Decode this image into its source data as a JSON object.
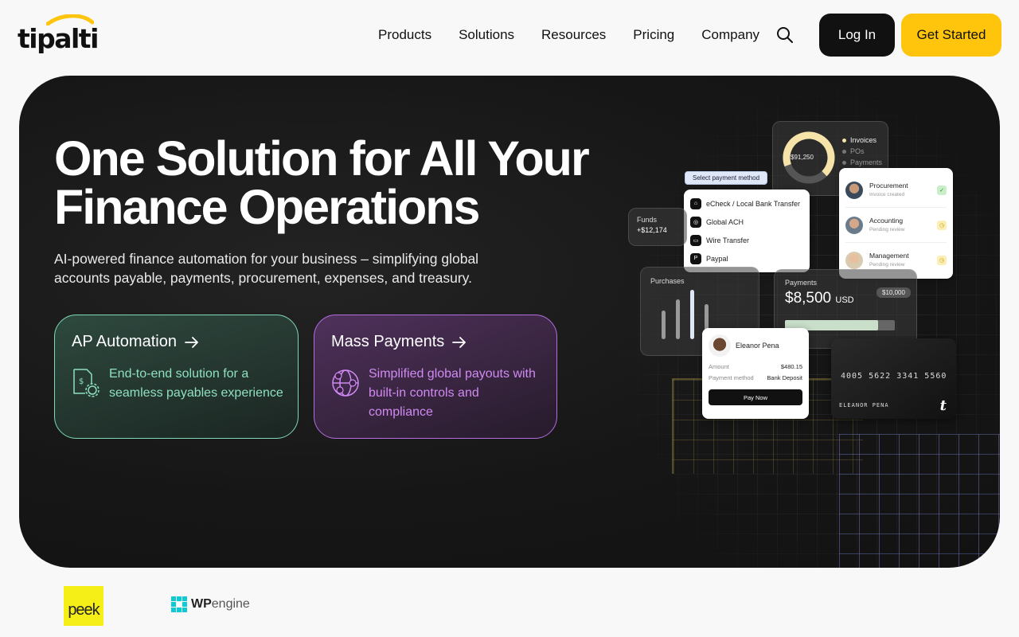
{
  "brand": {
    "name": "tipalti"
  },
  "nav": {
    "items": [
      "Products",
      "Solutions",
      "Resources",
      "Pricing",
      "Company"
    ],
    "login": "Log In",
    "get_started": "Get Started"
  },
  "hero": {
    "title_line1": "One Solution for All Your",
    "title_line2": "Finance Operations",
    "subtitle_line1": "AI-powered finance automation for your business – simplifying global",
    "subtitle_line2": "accounts payable, payments, procurement, expenses, and treasury.",
    "cards": [
      {
        "title": "AP Automation",
        "desc": "End-to-end solution for a seamless payables experience",
        "color": "#8ee0bf"
      },
      {
        "title": "Mass Payments",
        "desc": "Simplified global payouts with built-in controls and compliance",
        "color": "#d08af2"
      }
    ]
  },
  "mockup": {
    "donut_value": "$91,250",
    "donut_legend": [
      "Invoices",
      "POs",
      "Payments"
    ],
    "select_label": "Select payment method",
    "payment_methods": [
      "eCheck / Local Bank Transfer",
      "Global ACH",
      "Wire Transfer",
      "Paypal"
    ],
    "funds_label": "Funds",
    "funds_value": "+$12,174",
    "approvals": [
      {
        "role": "Procurement",
        "status": "Invoice created"
      },
      {
        "role": "Accounting",
        "status": "Pending review"
      },
      {
        "role": "Management",
        "status": "Pending review"
      }
    ],
    "purchases_label": "Purchases",
    "payments_label": "Payments",
    "payments_amount": "$8,500",
    "payments_currency": "USD",
    "payments_limit": "$10,000",
    "payments_progress": 0.85,
    "payee_name": "Eleanor Pena",
    "amount_label": "Amount",
    "amount_value": "$480.15",
    "method_label": "Payment method",
    "method_value": "Bank Deposit",
    "pay_now": "Pay Now",
    "card_number": "4005 5622 3341 5560",
    "card_name": "ELEANOR PENA",
    "card_brand": "t"
  },
  "clients": [
    {
      "name": "peek"
    },
    {
      "name_bold": "WP",
      "name_rest": "engine"
    }
  ],
  "colors": {
    "accent": "#ffc40c",
    "dark": "#111111",
    "green": "#7fd9b6",
    "purple": "#b46de0"
  }
}
